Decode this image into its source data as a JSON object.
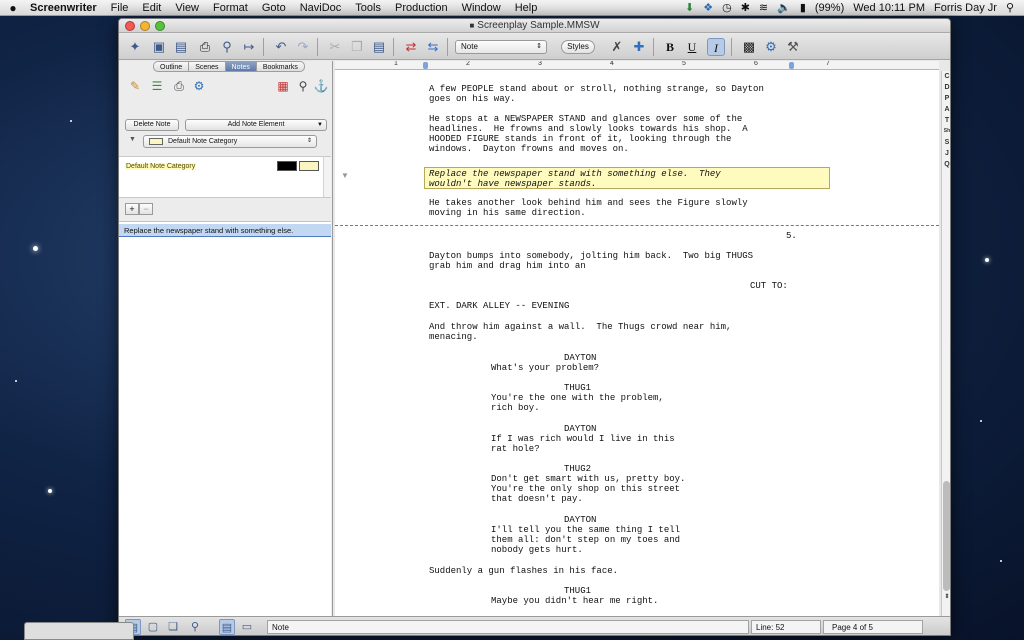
{
  "menubar": {
    "apple": "",
    "app_name": "Screenwriter",
    "items": [
      "File",
      "Edit",
      "View",
      "Format",
      "Goto",
      "NaviDoc",
      "Tools",
      "Production",
      "Window",
      "Help"
    ],
    "battery": "(99%)",
    "clock": "Wed 10:11 PM",
    "user": "Forris Day Jr"
  },
  "window": {
    "title": "Screenplay Sample.MMSW"
  },
  "toolbar": {
    "element_select": "Note",
    "styles_button": "Styles",
    "bold": "B",
    "underline": "U",
    "italic": "I"
  },
  "sidebar": {
    "tabs": [
      "Outline",
      "Scenes",
      "Notes",
      "Bookmarks"
    ],
    "active_tab": "Notes",
    "delete_note": "Delete Note",
    "add_note_element": "Add Note Element",
    "category_select": "Default Note Category",
    "categories": [
      {
        "name": "Default Note Category",
        "text_color": "#000000",
        "bg_color": "#fbf6c0"
      }
    ],
    "add": "+",
    "remove": "−",
    "notes": [
      "Replace the newspaper stand with something else."
    ]
  },
  "ruler": {
    "numbers": [
      "1",
      "2",
      "3",
      "4",
      "5",
      "6",
      "7"
    ]
  },
  "script": {
    "lines": [
      {
        "text": "A few PEOPLE stand about or stroll, nothing strange, so Dayton"
      },
      {
        "text": "goes on his way."
      },
      {
        "text": "He stops at a NEWSPAPER STAND and glances over some of the"
      },
      {
        "text": "headlines.  He frowns and slowly looks towards his shop.  A"
      },
      {
        "text": "HOODED FIGURE stands in front of it, looking through the"
      },
      {
        "text": "windows.  Dayton frowns and moves on."
      },
      {
        "text": "Replace the newspaper stand with something else.  They"
      },
      {
        "text": "wouldn't have newspaper stands."
      },
      {
        "text": "He takes another look behind him and sees the Figure slowly"
      },
      {
        "text": "moving in his same direction."
      },
      {
        "text": "5."
      },
      {
        "text": "Dayton bumps into somebody, jolting him back.  Two big THUGS"
      },
      {
        "text": "grab him and drag him into an"
      },
      {
        "text": "CUT TO:"
      },
      {
        "text": "EXT. DARK ALLEY -- EVENING"
      },
      {
        "text": "And throw him against a wall.  The Thugs crowd near him,"
      },
      {
        "text": "menacing."
      },
      {
        "text": "DAYTON"
      },
      {
        "text": "What's your problem?"
      },
      {
        "text": "THUG1"
      },
      {
        "text": "You're the one with the problem,"
      },
      {
        "text": "rich boy."
      },
      {
        "text": "DAYTON"
      },
      {
        "text": "If I was rich would I live in this"
      },
      {
        "text": "rat hole?"
      },
      {
        "text": "THUG2"
      },
      {
        "text": "Don't get smart with us, pretty boy."
      },
      {
        "text": "You're the only shop on this street"
      },
      {
        "text": "that doesn't pay."
      },
      {
        "text": "DAYTON"
      },
      {
        "text": "I'll tell you the same thing I tell"
      },
      {
        "text": "them all: don't step on my toes and"
      },
      {
        "text": "nobody gets hurt."
      },
      {
        "text": "Suddenly a gun flashes in his face."
      },
      {
        "text": "THUG1"
      },
      {
        "text": "Maybe you didn't hear me right."
      }
    ]
  },
  "right_strip": [
    "C",
    "D",
    "P",
    "A",
    "T",
    "Sh",
    "S",
    "J",
    "Q"
  ],
  "statusbar": {
    "element": "Note",
    "line": "Line:  52",
    "page": "Page 4 of 5"
  }
}
